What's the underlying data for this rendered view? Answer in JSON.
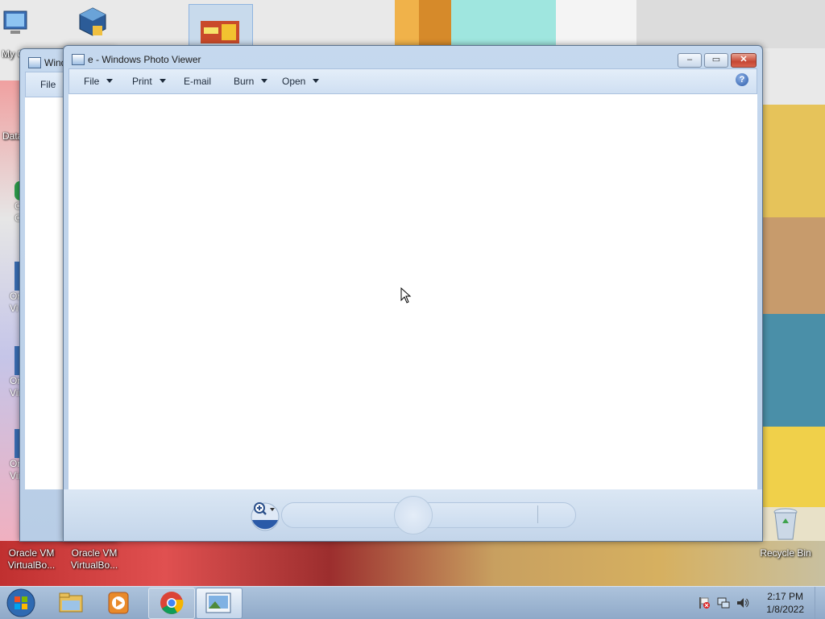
{
  "desktop": {
    "icons": [
      {
        "label": "My C",
        "icon": "computer-icon"
      },
      {
        "label": "",
        "icon": "virtualbox-icon"
      },
      {
        "label": "",
        "icon": "photo-thumbnail-icon"
      },
      {
        "label": "Data",
        "icon": "shortcut-icon"
      },
      {
        "label": "C\nC",
        "icon": "chrome-shortcut-icon"
      },
      {
        "label": "Or\nVi",
        "icon": "shortcut-icon"
      },
      {
        "label": "Or\nVir",
        "icon": "shortcut-icon"
      },
      {
        "label": "Or\nVir",
        "icon": "shortcut-icon"
      },
      {
        "label": "Oracle VM\nVirtualBo...",
        "icon": "virtualbox-icon"
      },
      {
        "label": "Oracle VM\nVirtualBo...",
        "icon": "virtualbox-icon"
      },
      {
        "label": "Recycle Bin",
        "icon": "recycle-bin-icon"
      }
    ]
  },
  "back_window": {
    "title": "Wind",
    "menu": [
      "File"
    ]
  },
  "photo_viewer": {
    "title": "e - Windows Photo Viewer",
    "menu": [
      {
        "label": "File",
        "dropdown": true
      },
      {
        "label": "Print",
        "dropdown": true
      },
      {
        "label": "E-mail",
        "dropdown": false
      },
      {
        "label": "Burn",
        "dropdown": true
      },
      {
        "label": "Open",
        "dropdown": true
      }
    ],
    "help_symbol": "?",
    "controls": {
      "minimize": "–",
      "maximize": "▭",
      "close": "✕"
    }
  },
  "taskbar": {
    "start": "start-orb-icon",
    "buttons": [
      "file-explorer-icon",
      "media-player-icon",
      "chrome-icon",
      "photo-viewer-icon"
    ],
    "clock": {
      "time": "2:17 PM",
      "date": "1/8/2022"
    }
  },
  "colors": {
    "window_frame": "#c5d8ee",
    "close_button": "#c54633",
    "taskbar": "#9fb6d2"
  }
}
